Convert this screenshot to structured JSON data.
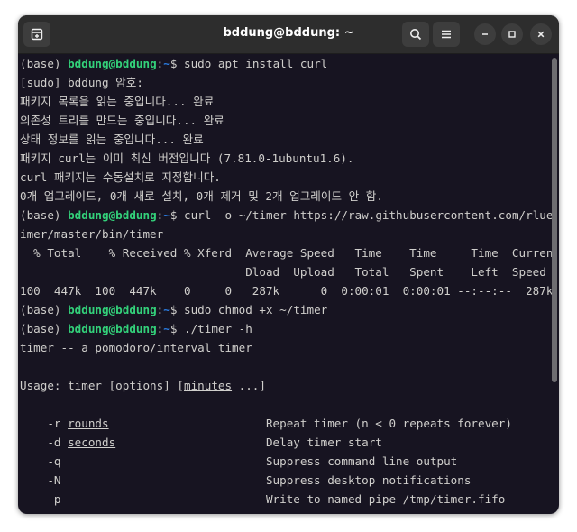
{
  "window": {
    "title": "bddung@bddung: ~"
  },
  "prompt": {
    "env": "(base) ",
    "user_host": "bddung@bddung",
    "colon": ":",
    "path": "~",
    "dollar": "$ "
  },
  "terminal": {
    "cmd1": "sudo apt install curl",
    "l2": "[sudo] bddung 암호:",
    "l3": "패키지 목록을 읽는 중입니다... 완료",
    "l4": "의존성 트리를 만드는 중입니다... 완료",
    "l5": "상태 정보를 읽는 중입니다... 완료",
    "l6": "패키지 curl는 이미 최신 버전입니다 (7.81.0-1ubuntu1.6).",
    "l7": "curl 패키지는 수동설치로 지정합니다.",
    "l8": "0개 업그레이드, 0개 새로 설치, 0개 제거 및 2개 업그레이드 안 함.",
    "cmd2": "curl -o ~/timer https://raw.githubusercontent.com/rlue/t",
    "l10": "imer/master/bin/timer",
    "l11": "  % Total    % Received % Xferd  Average Speed   Time    Time     Time  Current",
    "l12": "                                 Dload  Upload   Total   Spent    Left  Speed",
    "l13": "100  447k  100  447k    0     0   287k      0  0:00:01  0:00:01 --:--:--  287k",
    "cmd3": "sudo chmod +x ~/timer",
    "cmd4": "./timer -h",
    "l16": "timer -- a pomodoro/interval timer",
    "usage_prefix": "Usage: timer [options] [",
    "usage_arg": "minutes",
    "usage_suffix": " ...]",
    "options": [
      {
        "flag": "    -r ",
        "arg": "rounds",
        "pad": "                       ",
        "desc": "Repeat timer (n < 0 repeats forever)"
      },
      {
        "flag": "    -d ",
        "arg": "seconds",
        "pad": "                      ",
        "desc": "Delay timer start"
      },
      {
        "flag": "    -q",
        "arg": "",
        "pad": "                              ",
        "desc": "Suppress command line output"
      },
      {
        "flag": "    -N",
        "arg": "",
        "pad": "                              ",
        "desc": "Suppress desktop notifications"
      },
      {
        "flag": "    -p",
        "arg": "",
        "pad": "                              ",
        "desc": "Write to named pipe /tmp/timer.fifo"
      }
    ]
  }
}
